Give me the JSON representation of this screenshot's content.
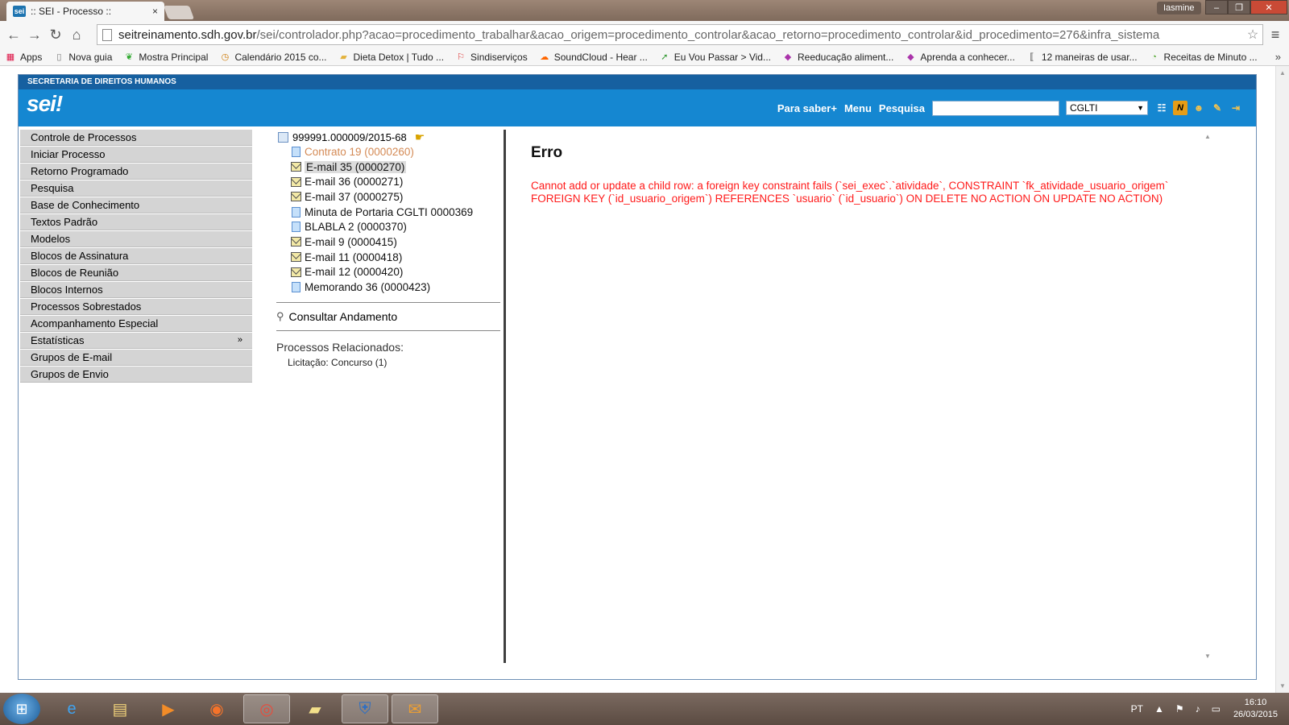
{
  "browser": {
    "tab_title": ":: SEI - Processo ::",
    "tab_favicon": "sei",
    "tab_close": "×",
    "user": "Iasmine",
    "url_host": "seitreinamento.sdh.gov.br",
    "url_path": "/sei/controlador.php?acao=procedimento_trabalhar&acao_origem=procedimento_controlar&acao_retorno=procedimento_controlar&id_procedimento=276&infra_sistema",
    "bookmarks": [
      {
        "label": "Apps",
        "icon": "apps-icon"
      },
      {
        "label": "Nova guia",
        "icon": "page-icon"
      },
      {
        "label": "Mostra Principal",
        "icon": "leaf-icon"
      },
      {
        "label": "Calendário 2015 co...",
        "icon": "calendar-icon"
      },
      {
        "label": "Dieta Detox | Tudo ...",
        "icon": "folder-icon"
      },
      {
        "label": "Sindiserviços",
        "icon": "flag-icon"
      },
      {
        "label": "SoundCloud - Hear ...",
        "icon": "soundcloud-icon"
      },
      {
        "label": "Eu Vou Passar > Vid...",
        "icon": "arrow-icon"
      },
      {
        "label": "Reeducação aliment...",
        "icon": "db-icon"
      },
      {
        "label": "Aprenda a conhecer...",
        "icon": "db-icon"
      },
      {
        "label": "12 maneiras de usar...",
        "icon": "brackets-icon"
      },
      {
        "label": "Receitas de Minuto ...",
        "icon": "clock-icon"
      }
    ],
    "bookmarks_more": "»"
  },
  "header": {
    "org": "SECRETARIA DE DIREITOS HUMANOS",
    "logo": "sei!",
    "para_saber": "Para saber+",
    "menu": "Menu",
    "pesquisa": "Pesquisa",
    "unit": "CGLTI",
    "unit_arrow": "▼"
  },
  "sidemenu": [
    "Controle de Processos",
    "Iniciar Processo",
    "Retorno Programado",
    "Pesquisa",
    "Base de Conhecimento",
    "Textos Padrão",
    "Modelos",
    "Blocos de Assinatura",
    "Blocos de Reunião",
    "Blocos Internos",
    "Processos Sobrestados",
    "Acompanhamento Especial",
    "Estatísticas",
    "Grupos de E-mail",
    "Grupos de Envio"
  ],
  "sidemenu_arrow": "»",
  "tree": {
    "root": "999991.000009/2015-68",
    "items": [
      {
        "label": "Contrato 19 (0000260)",
        "type": "doc",
        "state": "muted"
      },
      {
        "label": "E-mail 35 (0000270)",
        "type": "mail",
        "state": "selected"
      },
      {
        "label": "E-mail 36 (0000271)",
        "type": "mail",
        "state": ""
      },
      {
        "label": "E-mail 37 (0000275)",
        "type": "mail",
        "state": ""
      },
      {
        "label": "Minuta de Portaria CGLTI 0000369",
        "type": "doc",
        "state": ""
      },
      {
        "label": "BLABLA 2 (0000370)",
        "type": "doc",
        "state": ""
      },
      {
        "label": "E-mail 9 (0000415)",
        "type": "mail",
        "state": ""
      },
      {
        "label": "E-mail 11 (0000418)",
        "type": "mail",
        "state": ""
      },
      {
        "label": "E-mail 12 (0000420)",
        "type": "mail",
        "state": ""
      },
      {
        "label": "Memorando 36 (0000423)",
        "type": "doc",
        "state": ""
      }
    ],
    "consultar": "Consultar Andamento",
    "related_title": "Processos Relacionados:",
    "related_item": "Licitação: Concurso (1)"
  },
  "error": {
    "title": "Erro",
    "message": "Cannot add or update a child row: a foreign key constraint fails (`sei_exec`.`atividade`, CONSTRAINT `fk_atividade_usuario_origem` FOREIGN KEY (`id_usuario_origem`) REFERENCES `usuario` (`id_usuario`) ON DELETE NO ACTION ON UPDATE NO ACTION)"
  },
  "taskbar": {
    "lang": "PT",
    "time": "16:10",
    "date": "26/03/2015"
  },
  "colors": {
    "sei_blue": "#1587d1",
    "sdh_blue": "#1660a0",
    "error_red": "#ff1a1a"
  }
}
